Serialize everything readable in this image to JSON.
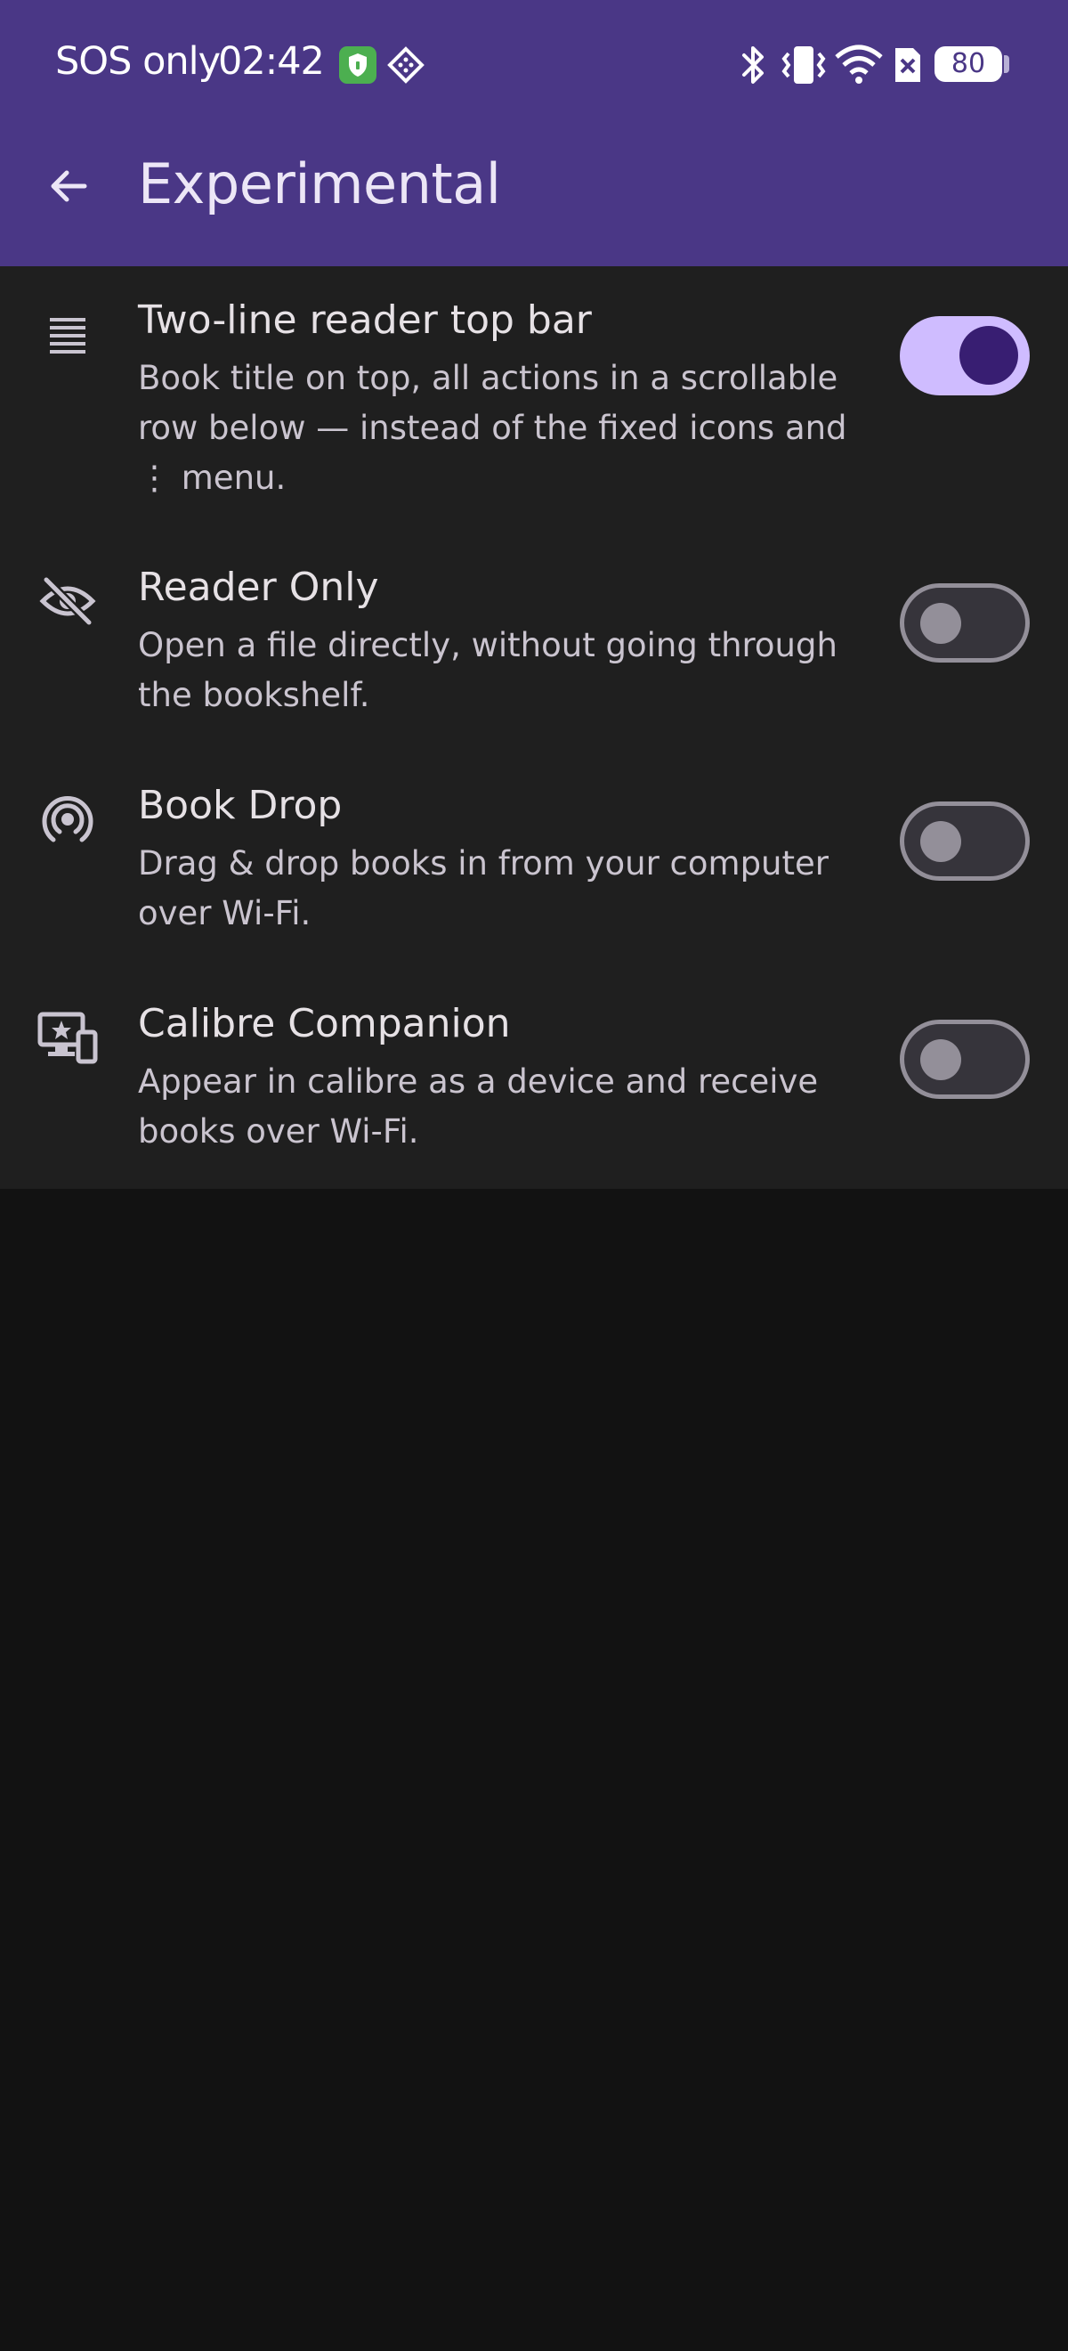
{
  "status_bar": {
    "carrier": "SOS only",
    "time": "02:42",
    "battery": "80",
    "icons": [
      "shield-icon",
      "diamond-icon",
      "bluetooth-icon",
      "vibrate-icon",
      "wifi-icon",
      "sim-off-icon",
      "battery-icon"
    ]
  },
  "app_bar": {
    "title": "Experimental",
    "back_icon": "arrow-back-icon"
  },
  "colors": {
    "app_bar": "#4a3786",
    "panel": "#1f1f1f",
    "background": "#121212",
    "switch_on_track": "#cfbcff",
    "switch_on_thumb": "#381e72",
    "switch_off_outline": "#938f99"
  },
  "settings": [
    {
      "icon": "reorder-lines-icon",
      "title": "Two-line reader top bar",
      "description": "Book title on top, all actions in a scrollable row below — instead of the fixed icons and ⋮ menu.",
      "enabled": true
    },
    {
      "icon": "eye-off-icon",
      "title": "Reader Only",
      "description": "Open a file directly, without going through the bookshelf.",
      "enabled": false
    },
    {
      "icon": "broadcast-icon",
      "title": "Book Drop",
      "description": "Drag & drop books in from your computer over Wi-Fi.",
      "enabled": false
    },
    {
      "icon": "devices-star-icon",
      "title": "Calibre Companion",
      "description": "Appear in calibre as a device and receive books over Wi-Fi.",
      "enabled": false
    }
  ]
}
